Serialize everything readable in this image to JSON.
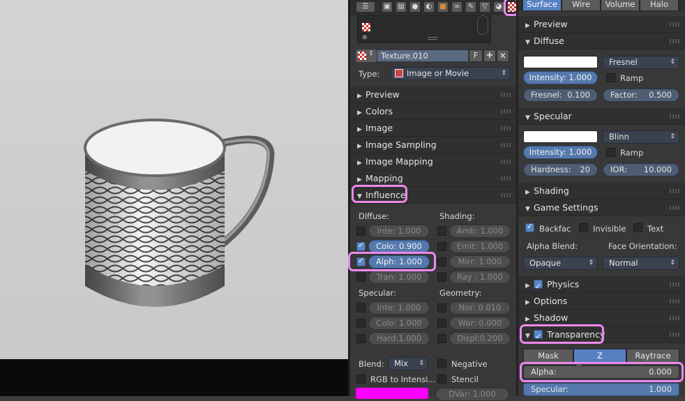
{
  "props": {
    "texture_name": "Texture.010",
    "fake_user": "F",
    "type_label": "Type:",
    "type_value": "Image or Movie",
    "panels": [
      "Preview",
      "Colors",
      "Image",
      "Image Sampling",
      "Image Mapping",
      "Mapping",
      "Influence"
    ],
    "influence": {
      "diffuse_label": "Diffuse:",
      "shading_label": "Shading:",
      "specular_label": "Specular:",
      "geometry_label": "Geometry:",
      "diffuse": [
        {
          "text": "Inte: 1.000",
          "checked": false
        },
        {
          "text": "Colo: 0.900",
          "checked": true
        },
        {
          "text": "Alph: 1.000",
          "checked": true
        },
        {
          "text": "Tran: 1.000",
          "checked": false
        }
      ],
      "shading": [
        {
          "text": "Amb: 1.000",
          "checked": false
        },
        {
          "text": "Emit: 1.000",
          "checked": false
        },
        {
          "text": "Mirr: 1.000",
          "checked": false
        },
        {
          "text": "Ray : 1.000",
          "checked": false
        }
      ],
      "specular": [
        {
          "text": "Inte: 1.000",
          "checked": false
        },
        {
          "text": "Colo: 1.000",
          "checked": false
        },
        {
          "text": "Hard:1.000",
          "checked": false
        }
      ],
      "geometry": [
        {
          "text": "Nor: 0.010",
          "checked": false
        },
        {
          "text": "War: 0.000",
          "checked": false
        },
        {
          "text": "Displ:0.200",
          "checked": false
        }
      ],
      "blend_label": "Blend:",
      "blend_value": "Mix",
      "negative_label": "Negative",
      "rgb_to_intensity_label": "RGB to Intensi...",
      "stencil_label": "Stencil",
      "dvar": "DVar: 1.000",
      "swatch_color": "#ff00ff"
    }
  },
  "material": {
    "tabs": [
      "Surface",
      "Wire",
      "Volume",
      "Halo"
    ],
    "preview_label": "Preview",
    "diffuse": {
      "header": "Diffuse",
      "shader": "Fresnel",
      "intensity": "Intensity: 1.000",
      "ramp_label": "Ramp",
      "fresnel_label": "Fresnel:",
      "fresnel_value": "0.100",
      "factor_label": "Factor:",
      "factor_value": "0.500"
    },
    "specular": {
      "header": "Specular",
      "shader": "Blinn",
      "intensity": "Intensity: 1.000",
      "ramp_label": "Ramp",
      "hardness_label": "Hardness:",
      "hardness_value": "20",
      "ior_label": "IOR:",
      "ior_value": "10.000"
    },
    "shading_header": "Shading",
    "game_settings": {
      "header": "Game Settings",
      "backface_label": "Backfac",
      "invisible_label": "Invisible",
      "text_label": "Text",
      "alpha_blend_label": "Alpha Blend:",
      "face_orientation_label": "Face Orientation:",
      "alpha_blend_value": "Opaque",
      "face_orientation_value": "Normal"
    },
    "physics_header": "Physics",
    "options_header": "Options",
    "shadow_header": "Shadow",
    "transparency": {
      "header": "Transparency",
      "modes": [
        "Mask",
        "Z Transpare...",
        "Raytrace"
      ],
      "alpha_label": "Alpha:",
      "alpha_value": "0.000",
      "specular_label": "Specular:",
      "specular_value": "1.000"
    }
  }
}
